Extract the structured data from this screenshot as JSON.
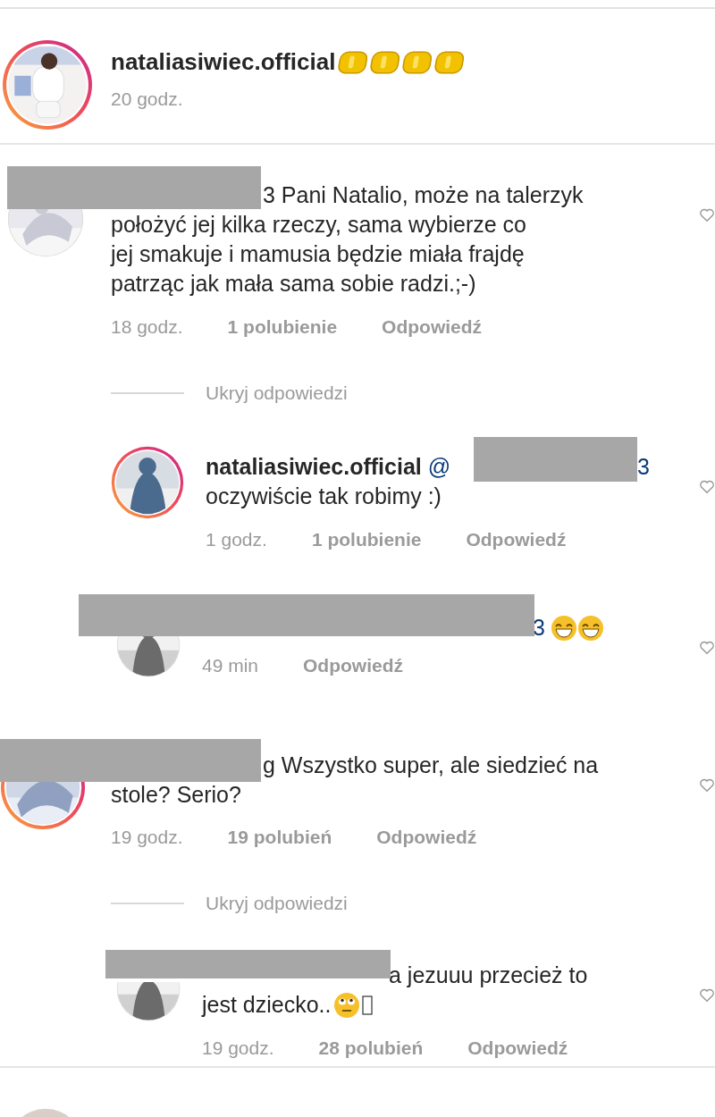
{
  "post": {
    "username": "nataliasiwiec.official",
    "time": "20 godz.",
    "story_ring": true
  },
  "comments": [
    {
      "lines": [
        "3 Pani Natalio, może na talerzyk",
        "położyć jej kilka rzeczy, sama wybierze co",
        "jej smakuje i mamusia będzie miała frajdę",
        "patrząc jak mała sama sobie radzi.;-)"
      ],
      "time": "18 godz.",
      "likes": "1 polubienie",
      "reply": "Odpowiedź",
      "story_ring": false,
      "replies_toggle": "Ukryj odpowiedzi",
      "replies": [
        {
          "username": "nataliasiwiec.official",
          "mention_start": "@",
          "mention_end": "3",
          "lines": [
            "oczywiście tak robimy :)"
          ],
          "time": "1 godz.",
          "likes": "1 polubienie",
          "reply": "Odpowiedź",
          "story_ring": true
        },
        {
          "mention_end": "3",
          "time": "49 min",
          "reply": "Odpowiedź",
          "story_ring": false
        }
      ]
    },
    {
      "lines": [
        "g Wszystko super, ale siedzieć na",
        "stole? Serio?"
      ],
      "time": "19 godz.",
      "likes": "19 polubień",
      "reply": "Odpowiedź",
      "story_ring": true,
      "replies_toggle": "Ukryj odpowiedzi",
      "replies": [
        {
          "lines": [
            "a jezuuu przecież to",
            "jest dziecko.."
          ],
          "time": "19 godz.",
          "likes": "28 polubień",
          "reply": "Odpowiedź",
          "story_ring": false
        }
      ]
    }
  ]
}
